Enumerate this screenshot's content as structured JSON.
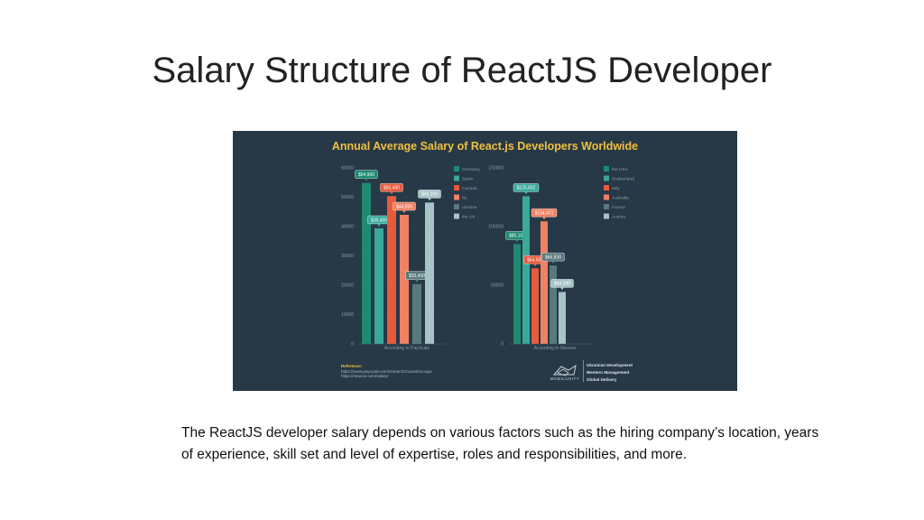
{
  "slide": {
    "title": "Salary Structure of ReactJS Developer",
    "body": "The ReactJS developer salary depends on various factors such as the hiring company’s location, years of experience, skill set and level of expertise, roles and responsibilities, and more."
  },
  "infographic": {
    "title": "Annual Average Salary of React.js Developers Worldwide",
    "references_label": "Reference:",
    "references": [
      "https://www.payscale.com/research/countries.aspx",
      "https://neuvoo.com/salary/"
    ],
    "brand_name": "MOBILUNITY",
    "brand_lines": [
      "Ukrainian Development",
      "Western Management",
      "Global Delivery"
    ],
    "background_color": "#273846",
    "title_color": "#f0c040"
  },
  "chart_data": [
    {
      "type": "bar",
      "categories": [
        "According to PayScale"
      ],
      "series": [
        {
          "name": "Germany",
          "value": 54900,
          "label": "$54,900",
          "color": "#1e8a72"
        },
        {
          "name": "Spain",
          "value": 39400,
          "label": "$39,400",
          "color": "#3aa99a"
        },
        {
          "name": "Canada",
          "value": 50400,
          "label": "$50,400",
          "color": "#e85a3c"
        },
        {
          "name": "NL",
          "value": 44000,
          "label": "$44,000",
          "color": "#f08264"
        },
        {
          "name": "Ukraine",
          "value": 20400,
          "label": "$20,400",
          "color": "#577a7e"
        },
        {
          "name": "the UK",
          "value": 48200,
          "label": "$48,200",
          "color": "#a7c4c8"
        }
      ],
      "yticks": [
        "0",
        "10000",
        "20000",
        "30000",
        "40000",
        "50000",
        "60000"
      ],
      "ylim": [
        0,
        60000
      ],
      "xlabel": "According to PayScale",
      "legend_position": "top-right"
    },
    {
      "type": "bar",
      "categories": [
        "According to Neuvoo"
      ],
      "series": [
        {
          "name": "the USA",
          "value": 85102,
          "label": "$85,102",
          "color": "#1e8a72"
        },
        {
          "name": "Switzerland",
          "value": 125832,
          "label": "$125,832",
          "color": "#3aa99a"
        },
        {
          "name": "Italy",
          "value": 64500,
          "label": "$64,500",
          "color": "#e85a3c"
        },
        {
          "name": "Australia",
          "value": 104471,
          "label": "$104,471",
          "color": "#f08264"
        },
        {
          "name": "France",
          "value": 66830,
          "label": "$66,830",
          "color": "#577a7e"
        },
        {
          "name": "Austria",
          "value": 44290,
          "label": "$44,290",
          "color": "#a7c4c8"
        }
      ],
      "yticks": [
        "0",
        "50000",
        "100000",
        "150000"
      ],
      "ylim": [
        0,
        150000
      ],
      "xlabel": "According to Neuvoo",
      "legend_position": "top-right"
    }
  ]
}
